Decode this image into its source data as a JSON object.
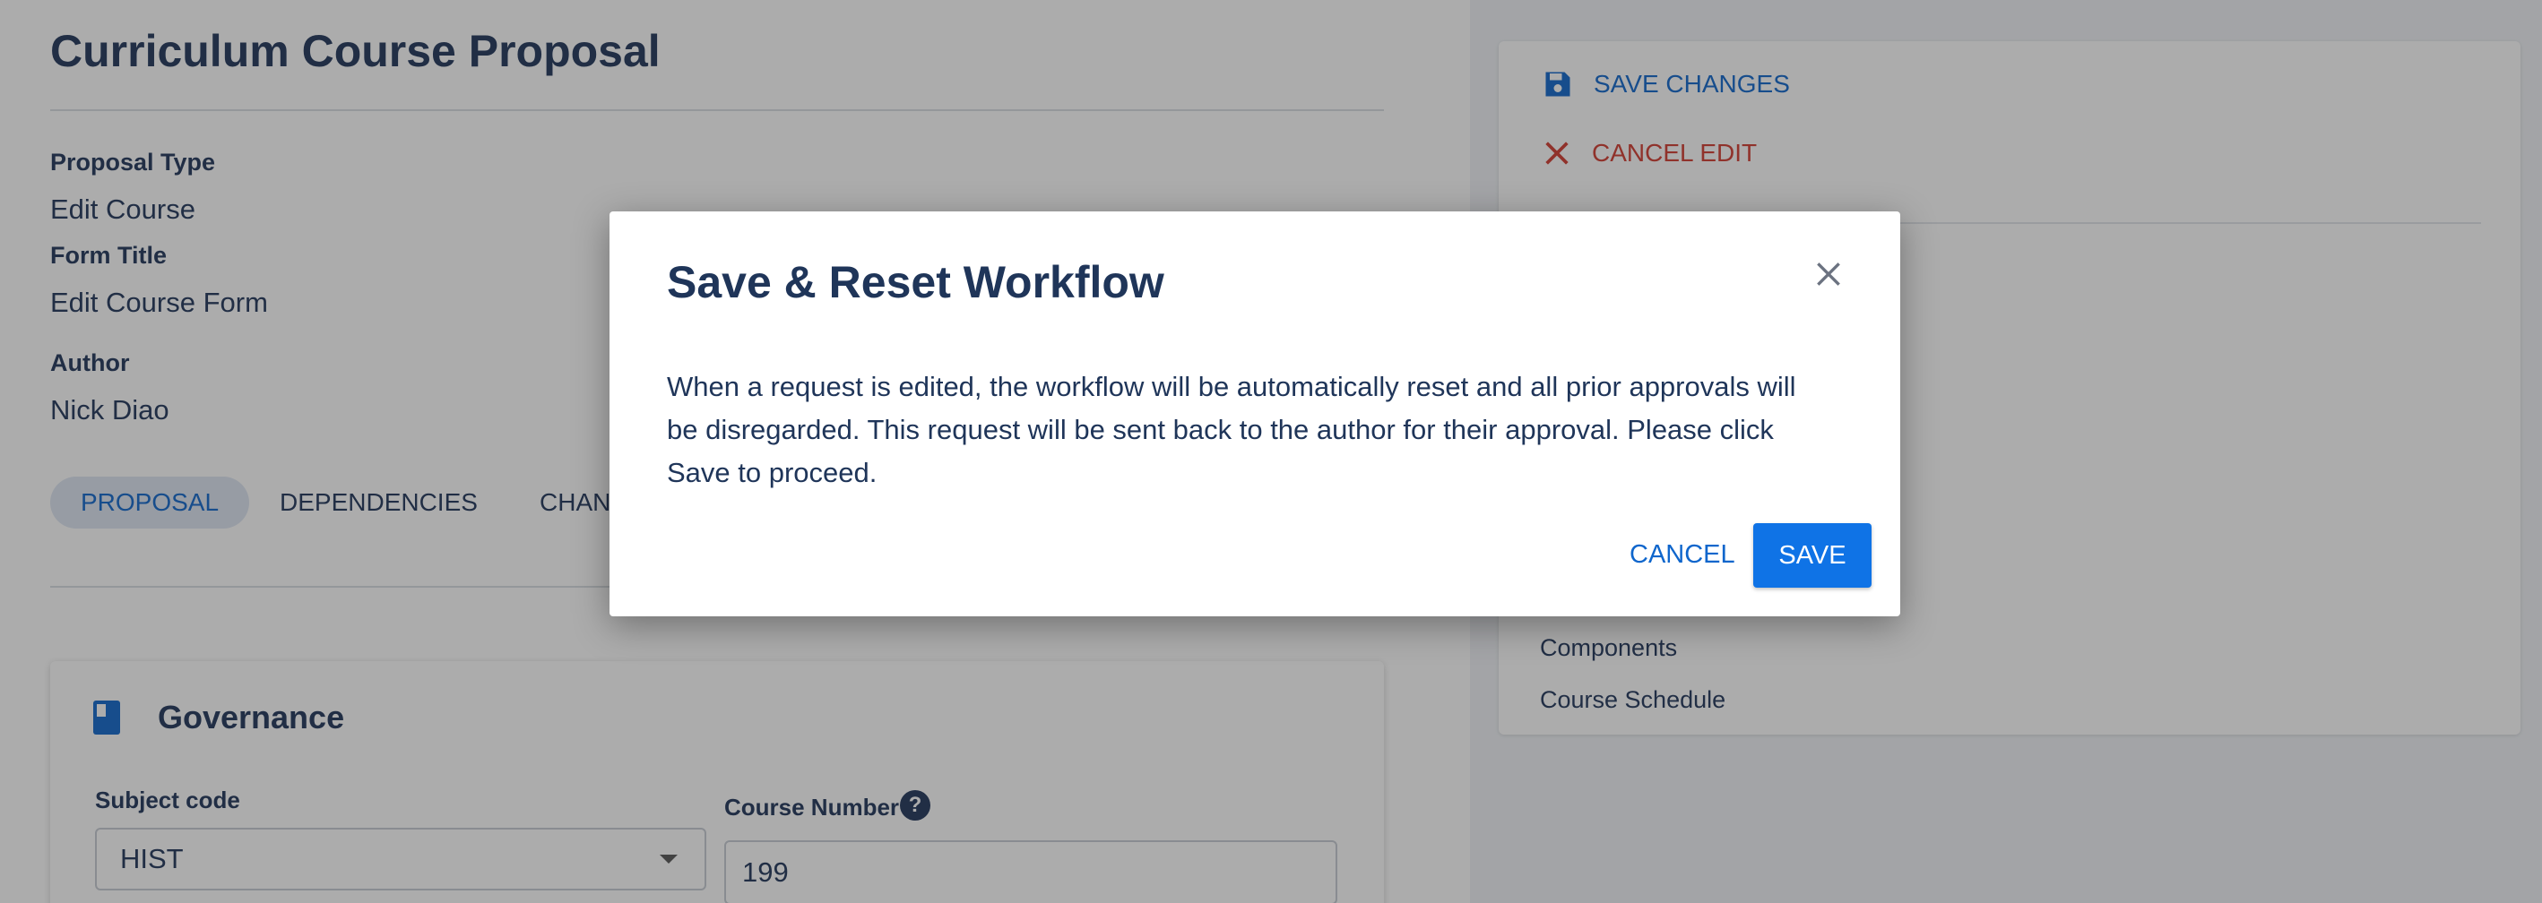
{
  "page": {
    "title": "Curriculum Course Proposal"
  },
  "fields": [
    {
      "label": "Proposal Type",
      "value": "Edit Course"
    },
    {
      "label": "Form Title",
      "value": "Edit Course Form"
    },
    {
      "label": "Author",
      "value": "Nick Diao"
    }
  ],
  "tabs": [
    {
      "label": "PROPOSAL",
      "active": true
    },
    {
      "label": "DEPENDENCIES",
      "active": false
    },
    {
      "label": "CHAN",
      "active": false
    }
  ],
  "governance": {
    "title": "Governance",
    "icon": "book-icon",
    "subject_code_label": "Subject code",
    "subject_code_value": "HIST",
    "course_number_label": "Course Number",
    "course_number_value": "199",
    "help_icon": "question-icon"
  },
  "sidebar": {
    "save_label": "SAVE CHANGES",
    "cancel_label": "CANCEL EDIT",
    "links": [
      "Components",
      "Course Schedule"
    ]
  },
  "modal": {
    "title": "Save & Reset Workflow",
    "body": "When a request is edited, the workflow will be automatically reset and all prior approvals will be disregarded. This request will be sent back to the author for their approval. Please click Save to proceed.",
    "cancel_label": "CANCEL",
    "save_label": "SAVE"
  },
  "colors": {
    "primary": "#0f73e6",
    "link": "#0f66cc",
    "danger": "#d23a2f",
    "text": "#1f3559"
  }
}
